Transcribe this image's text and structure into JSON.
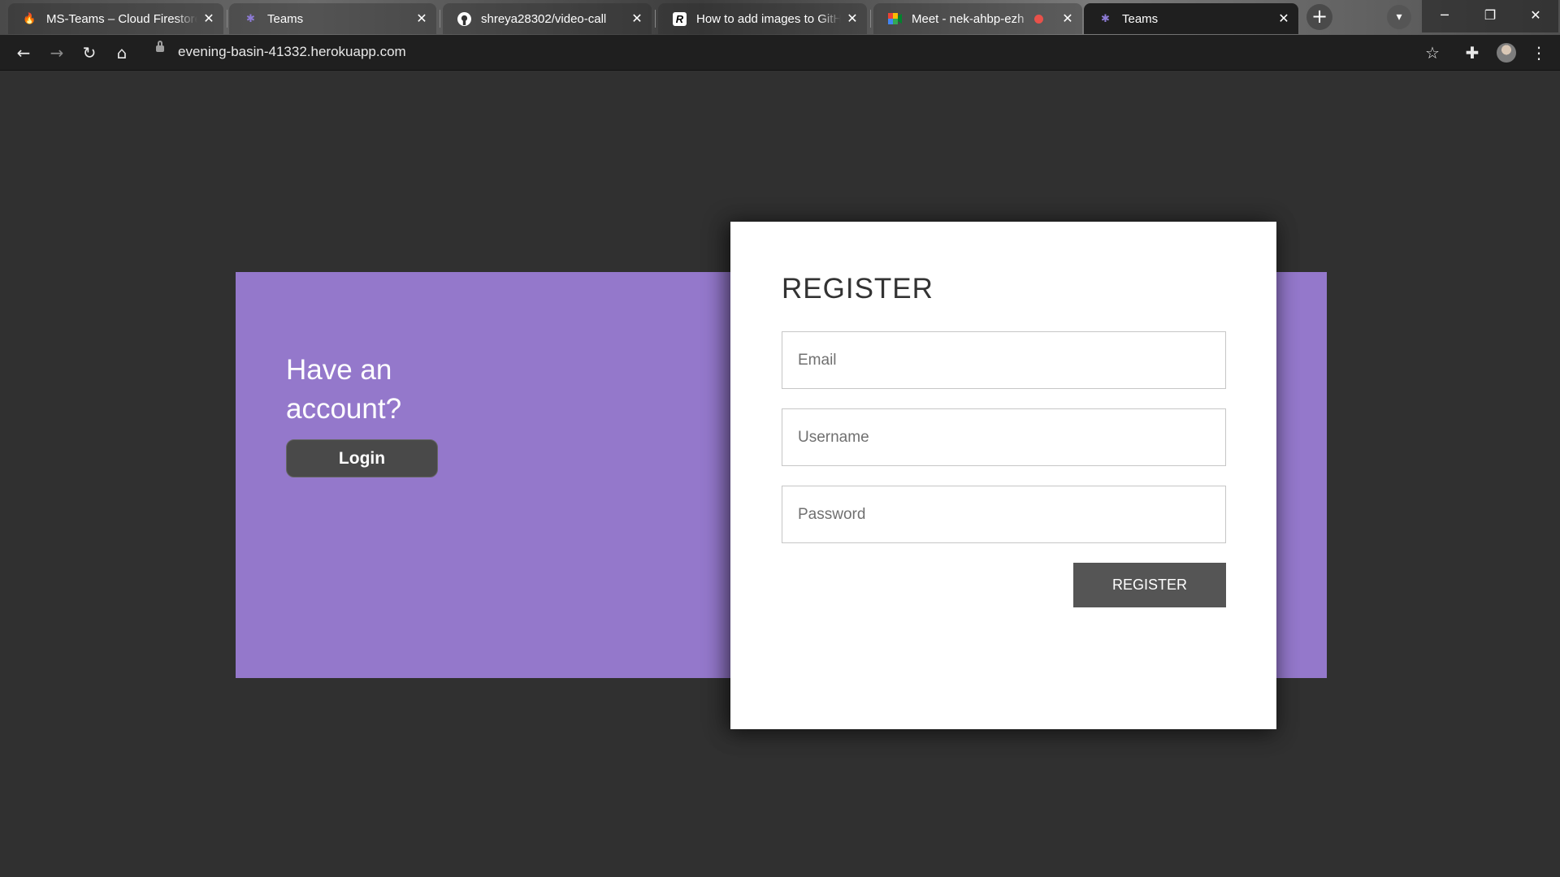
{
  "browser": {
    "tabs": [
      {
        "title": "MS-Teams – Cloud Firestore",
        "favicon": "firebase-icon",
        "active": false
      },
      {
        "title": "Teams",
        "favicon": "teams-icon",
        "active": false
      },
      {
        "title": "shreya28302/video-call",
        "favicon": "github-icon",
        "active": false
      },
      {
        "title": "How to add images to GitHub",
        "favicon": "r-logo-icon",
        "active": false
      },
      {
        "title": "Meet - nek-ahbp-ezh",
        "favicon": "google-meet-icon",
        "active": false,
        "recording": true
      },
      {
        "title": "Teams",
        "favicon": "teams-icon",
        "active": true
      }
    ],
    "url": "evening-basin-41332.herokuapp.com"
  },
  "page": {
    "have_account_text": "Have an account?",
    "login_label": "Login",
    "register_title": "REGISTER",
    "email_placeholder": "Email",
    "username_placeholder": "Username",
    "password_placeholder": "Password",
    "register_button_label": "REGISTER"
  },
  "colors": {
    "background": "#303030",
    "accent_purple": "#9478cb",
    "button_dark": "#555555"
  }
}
